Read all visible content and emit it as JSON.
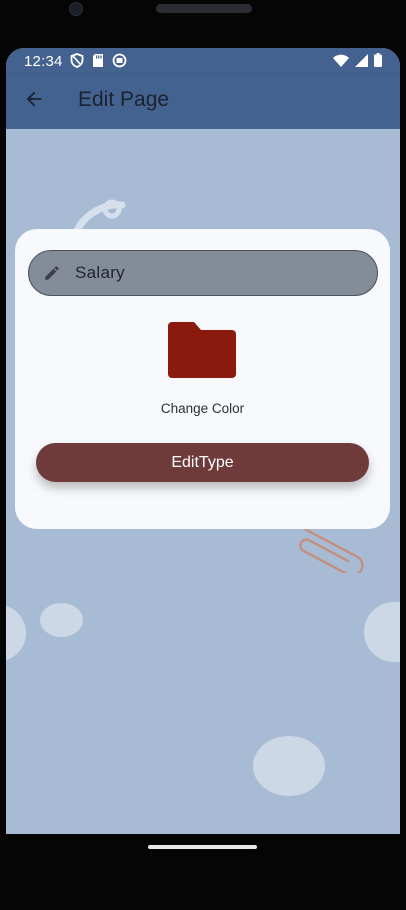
{
  "status_bar": {
    "time": "12:34",
    "left_icons": [
      "shield-icon",
      "sd-card-icon",
      "notification-app-icon"
    ],
    "right_icons": [
      "wifi-icon",
      "cell-signal-icon",
      "battery-icon"
    ]
  },
  "app_bar": {
    "title": "Edit Page",
    "back_icon": "arrow-back-icon"
  },
  "form": {
    "name_field": {
      "value": "Salary",
      "icon": "pencil-icon"
    },
    "folder_icon": "folder-icon",
    "folder_color": "#8b1a0e",
    "change_color_label": "Change Color",
    "submit_label": "EditType"
  },
  "colors": {
    "app_bar": "#44628f",
    "background": "#a8bbd5",
    "card": "#f7f9fc",
    "field_fill": "#848c97",
    "button": "#6e3a3a"
  },
  "decorations": [
    "dollar-sign-icon",
    "paperclip-icon"
  ]
}
